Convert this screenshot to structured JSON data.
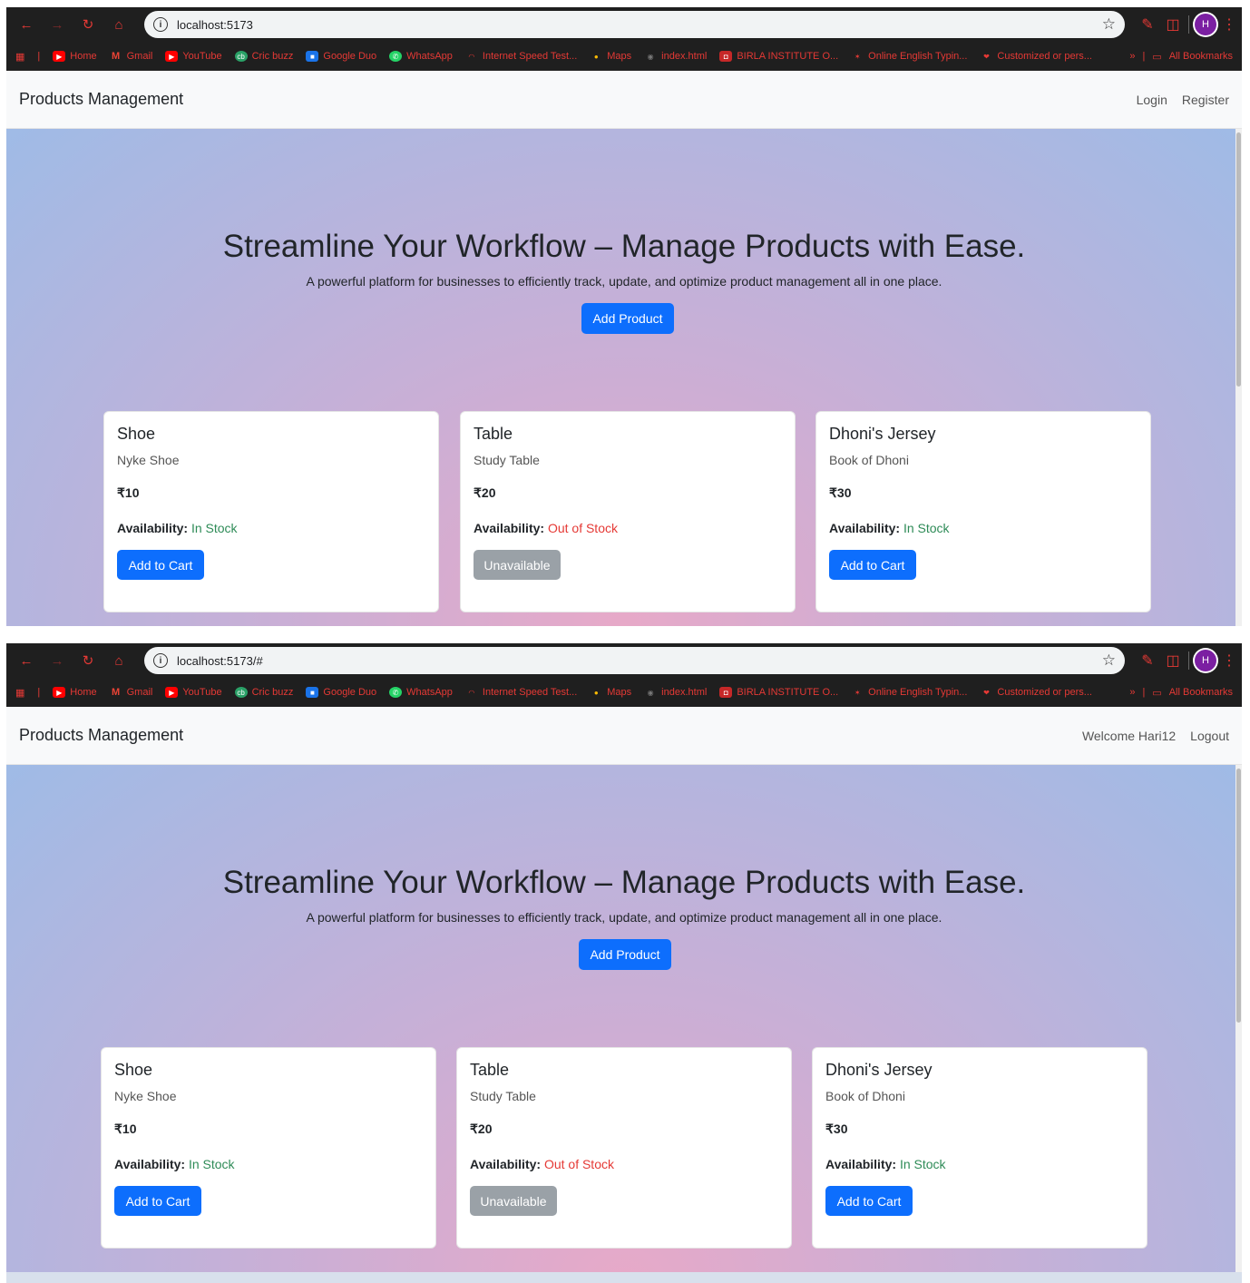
{
  "screens": [
    {
      "url": "localhost:5173",
      "nav_links": [
        "Login",
        "Register"
      ]
    },
    {
      "url": "localhost:5173/#",
      "nav_links": [
        "Welcome Hari12",
        "Logout"
      ]
    }
  ],
  "browser": {
    "avatar_letter": "H",
    "bookmarks": [
      "Home",
      "Gmail",
      "YouTube",
      "Cric buzz",
      "Google Duo",
      "WhatsApp",
      "Internet Speed Test...",
      "Maps",
      "index.html",
      "BIRLA INSTITUTE O...",
      "Online English Typin...",
      "Customized or pers..."
    ],
    "all_bookmarks": "All Bookmarks",
    "more": "»"
  },
  "app": {
    "brand": "Products Management",
    "hero_title": "Streamline Your Workflow – Manage Products with Ease.",
    "hero_subtitle": "A powerful platform for businesses to efficiently track, update, and optimize product management all in one place.",
    "add_product": "Add Product",
    "availability_label": "Availability:",
    "products": [
      {
        "name": "Shoe",
        "description": "Nyke Shoe",
        "price": "₹10",
        "status": "In Stock",
        "action": "Add to Cart"
      },
      {
        "name": "Table",
        "description": "Study Table",
        "price": "₹20",
        "status": "Out of Stock",
        "action": "Unavailable"
      },
      {
        "name": "Dhoni's Jersey",
        "description": "Book of Dhoni",
        "price": "₹30",
        "status": "In Stock",
        "action": "Add to Cart"
      }
    ]
  },
  "colors": {
    "primary": "#0d6efd",
    "in_stock": "#2e8b57",
    "out_of_stock": "#e53935",
    "disabled": "#9aa1a7"
  }
}
